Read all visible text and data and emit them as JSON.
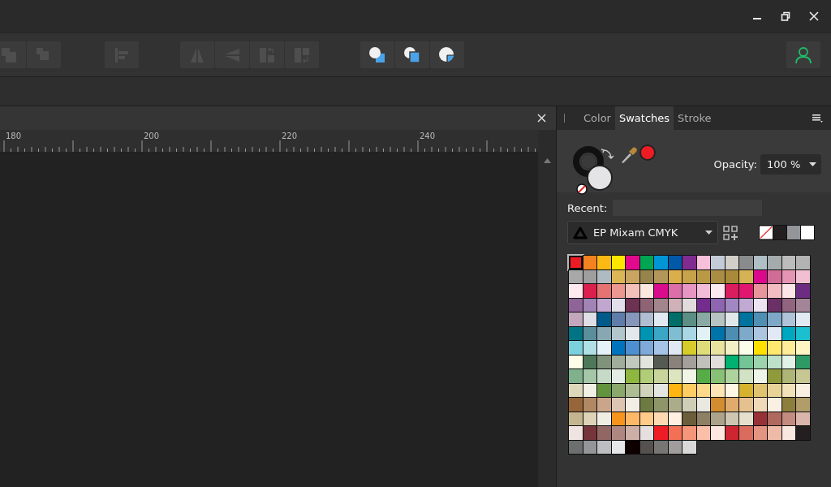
{
  "toolbar": {
    "groups": [
      {
        "buttons": [
          {
            "kind": "arrange_back",
            "disabled": true
          },
          {
            "kind": "arrange_backward",
            "disabled": true
          }
        ]
      },
      {
        "buttons": [
          {
            "kind": "align",
            "disabled": true
          }
        ]
      },
      {
        "buttons": [
          {
            "kind": "flip_h",
            "disabled": true
          },
          {
            "kind": "flip_v",
            "disabled": true
          },
          {
            "kind": "rotate_ccw",
            "disabled": true
          },
          {
            "kind": "rotate_cw",
            "disabled": true
          }
        ]
      },
      {
        "buttons": [
          {
            "kind": "add",
            "disabled": false
          },
          {
            "kind": "subtract",
            "disabled": false
          },
          {
            "kind": "intersect",
            "disabled": false
          }
        ]
      }
    ]
  },
  "ruler": {
    "labels": [
      "180",
      "200",
      "220",
      "240"
    ]
  },
  "panel": {
    "tabs": [
      {
        "label": "Color",
        "selected": false
      },
      {
        "label": "Swatches",
        "selected": true
      },
      {
        "label": "Stroke",
        "selected": false
      }
    ],
    "opacity": {
      "label": "Opacity:",
      "value": "100 %"
    },
    "recent": {
      "label": "Recent:"
    },
    "palette": {
      "name": "EP Mixam CMYK"
    },
    "quick_swatches": [
      {
        "kind": "none"
      },
      {
        "kind": "color",
        "color": "#231f20"
      },
      {
        "kind": "color",
        "color": "#939598"
      },
      {
        "kind": "color",
        "color": "#ffffff"
      }
    ],
    "swatches": [
      {
        "color": "#ed1c24",
        "selected": true
      },
      {
        "color": "#f58220",
        "selected": false
      },
      {
        "color": "#fdb913",
        "selected": false
      },
      {
        "color": "#ffe600",
        "selected": false
      },
      {
        "color": "#e20a8c",
        "selected": false
      },
      {
        "color": "#00a651",
        "selected": false
      },
      {
        "color": "#0096d6",
        "selected": false
      },
      {
        "color": "#0058a7",
        "selected": false
      },
      {
        "color": "#7f2b8f",
        "selected": false
      },
      {
        "color": "#f8bfd8",
        "selected": false
      },
      {
        "color": "#c3cbd8",
        "selected": false
      },
      {
        "color": "#d1cfc8",
        "selected": false
      },
      {
        "color": "#8a8b8d",
        "selected": false
      },
      {
        "color": "#b0bec5",
        "selected": false
      },
      {
        "color": "#a5abac",
        "selected": false
      },
      {
        "color": "#bcbcbc",
        "selected": false
      },
      {
        "color": "#b3b3b3",
        "selected": false
      },
      {
        "color": "#a8a8a8",
        "selected": false
      },
      {
        "color": "#9e9e9e",
        "selected": false
      },
      {
        "color": "#b0bac2",
        "selected": false
      },
      {
        "color": "#dcb556",
        "selected": false
      },
      {
        "color": "#c8a560",
        "selected": false
      },
      {
        "color": "#97834c",
        "selected": false
      },
      {
        "color": "#b39659",
        "selected": false
      },
      {
        "color": "#daae4a",
        "selected": false
      },
      {
        "color": "#c6a24a",
        "selected": false
      },
      {
        "color": "#b99945",
        "selected": false
      },
      {
        "color": "#a98d44",
        "selected": false
      },
      {
        "color": "#a98a3b",
        "selected": false
      },
      {
        "color": "#d5b253",
        "selected": false
      },
      {
        "color": "#db0a8c",
        "selected": false
      },
      {
        "color": "#d16c96",
        "selected": false
      },
      {
        "color": "#e595b3",
        "selected": false
      },
      {
        "color": "#f1bfd1",
        "selected": false
      },
      {
        "color": "#fde9ee",
        "selected": false
      },
      {
        "color": "#dc1f4d",
        "selected": false
      },
      {
        "color": "#e57372",
        "selected": false
      },
      {
        "color": "#ec9891",
        "selected": false
      },
      {
        "color": "#f3c0ba",
        "selected": false
      },
      {
        "color": "#fde8df",
        "selected": false
      },
      {
        "color": "#d80c8c",
        "selected": false
      },
      {
        "color": "#dc6ea9",
        "selected": false
      },
      {
        "color": "#e796c4",
        "selected": false
      },
      {
        "color": "#f2bcd9",
        "selected": false
      },
      {
        "color": "#fde9f1",
        "selected": false
      },
      {
        "color": "#da1d5f",
        "selected": false
      },
      {
        "color": "#e0166f",
        "selected": false
      },
      {
        "color": "#e8959c",
        "selected": false
      },
      {
        "color": "#f2bcc2",
        "selected": false
      },
      {
        "color": "#fde6e7",
        "selected": false
      },
      {
        "color": "#6c2c82",
        "selected": false
      },
      {
        "color": "#8f6499",
        "selected": false
      },
      {
        "color": "#a283b5",
        "selected": false
      },
      {
        "color": "#c1a6cf",
        "selected": false
      },
      {
        "color": "#e2dfeb",
        "selected": false
      },
      {
        "color": "#6d3152",
        "selected": false
      },
      {
        "color": "#8e6474",
        "selected": false
      },
      {
        "color": "#a2868c",
        "selected": false
      },
      {
        "color": "#cfb1b7",
        "selected": false
      },
      {
        "color": "#e1dcdb",
        "selected": false
      },
      {
        "color": "#742c8e",
        "selected": false
      },
      {
        "color": "#8e65b0",
        "selected": false
      },
      {
        "color": "#a288c2",
        "selected": false
      },
      {
        "color": "#c1a9d4",
        "selected": false
      },
      {
        "color": "#ece4f1",
        "selected": false
      },
      {
        "color": "#6b3166",
        "selected": false
      },
      {
        "color": "#916580",
        "selected": false
      },
      {
        "color": "#a48499",
        "selected": false
      },
      {
        "color": "#c2a7bd",
        "selected": false
      },
      {
        "color": "#e1dfe6",
        "selected": false
      },
      {
        "color": "#005a8a",
        "selected": false
      },
      {
        "color": "#607ca8",
        "selected": false
      },
      {
        "color": "#8797bb",
        "selected": false
      },
      {
        "color": "#b1bdd1",
        "selected": false
      },
      {
        "color": "#e3e9f1",
        "selected": false
      },
      {
        "color": "#006e68",
        "selected": false
      },
      {
        "color": "#5b8e85",
        "selected": false
      },
      {
        "color": "#8ba9a4",
        "selected": false
      },
      {
        "color": "#b6c4c2",
        "selected": false
      },
      {
        "color": "#e2e7ea",
        "selected": false
      },
      {
        "color": "#00739f",
        "selected": false
      },
      {
        "color": "#4f8fb4",
        "selected": false
      },
      {
        "color": "#7fa8c8",
        "selected": false
      },
      {
        "color": "#b0c4d9",
        "selected": false
      },
      {
        "color": "#e1e9f3",
        "selected": false
      },
      {
        "color": "#007385",
        "selected": false
      },
      {
        "color": "#5a8e9b",
        "selected": false
      },
      {
        "color": "#87a8b3",
        "selected": false
      },
      {
        "color": "#b3c6cc",
        "selected": false
      },
      {
        "color": "#e2e8eb",
        "selected": false
      },
      {
        "color": "#0093b2",
        "selected": false
      },
      {
        "color": "#3ba6c5",
        "selected": false
      },
      {
        "color": "#7fbdd2",
        "selected": false
      },
      {
        "color": "#a8d6e2",
        "selected": false
      },
      {
        "color": "#e1f1f6",
        "selected": false
      },
      {
        "color": "#0073a8",
        "selected": false
      },
      {
        "color": "#4e8eb3",
        "selected": false
      },
      {
        "color": "#7ea9c9",
        "selected": false
      },
      {
        "color": "#adc6df",
        "selected": false
      },
      {
        "color": "#e2e9f5",
        "selected": false
      },
      {
        "color": "#00a8bf",
        "selected": false
      },
      {
        "color": "#1bbfd0",
        "selected": false
      },
      {
        "color": "#7bd0de",
        "selected": false
      },
      {
        "color": "#b0e0e5",
        "selected": false
      },
      {
        "color": "#e3f3f7",
        "selected": false
      },
      {
        "color": "#0073bd",
        "selected": false
      },
      {
        "color": "#4d8fcf",
        "selected": false
      },
      {
        "color": "#7fa9d9",
        "selected": false
      },
      {
        "color": "#a5c4e8",
        "selected": false
      },
      {
        "color": "#e1e8f5",
        "selected": false
      },
      {
        "color": "#d6cc2a",
        "selected": false
      },
      {
        "color": "#dedd7a",
        "selected": false
      },
      {
        "color": "#e9e3a0",
        "selected": false
      },
      {
        "color": "#f3f0c6",
        "selected": false
      },
      {
        "color": "#fbfde8",
        "selected": false
      },
      {
        "color": "#ffe000",
        "selected": false
      },
      {
        "color": "#ffe86e",
        "selected": false
      },
      {
        "color": "#ffec9b",
        "selected": false
      },
      {
        "color": "#fef5c4",
        "selected": false
      },
      {
        "color": "#fffde7",
        "selected": false
      },
      {
        "color": "#4e7859",
        "selected": false
      },
      {
        "color": "#7f937a",
        "selected": false
      },
      {
        "color": "#a0ad9b",
        "selected": false
      },
      {
        "color": "#c1c9bf",
        "selected": false
      },
      {
        "color": "#e1e5de",
        "selected": false
      },
      {
        "color": "#555b52",
        "selected": false
      },
      {
        "color": "#8a817b",
        "selected": false
      },
      {
        "color": "#a39f9a",
        "selected": false
      },
      {
        "color": "#c2c0bb",
        "selected": false
      },
      {
        "color": "#e2dedb",
        "selected": false
      },
      {
        "color": "#00b271",
        "selected": false
      },
      {
        "color": "#74c595",
        "selected": false
      },
      {
        "color": "#9dd4ae",
        "selected": false
      },
      {
        "color": "#bee2c9",
        "selected": false
      },
      {
        "color": "#e3f2e6",
        "selected": false
      },
      {
        "color": "#2e9a66",
        "selected": false
      },
      {
        "color": "#7fb28c",
        "selected": false
      },
      {
        "color": "#a3c7a7",
        "selected": false
      },
      {
        "color": "#c5dbc8",
        "selected": false
      },
      {
        "color": "#e4ede5",
        "selected": false
      },
      {
        "color": "#8db73f",
        "selected": false
      },
      {
        "color": "#b1cd77",
        "selected": false
      },
      {
        "color": "#c7d49b",
        "selected": false
      },
      {
        "color": "#dce4c0",
        "selected": false
      },
      {
        "color": "#f1f5e6",
        "selected": false
      },
      {
        "color": "#57ac48",
        "selected": false
      },
      {
        "color": "#88c175",
        "selected": false
      },
      {
        "color": "#afd39d",
        "selected": false
      },
      {
        "color": "#d1e3c4",
        "selected": false
      },
      {
        "color": "#eef6ea",
        "selected": false
      },
      {
        "color": "#8f9a3d",
        "selected": false
      },
      {
        "color": "#aeb576",
        "selected": false
      },
      {
        "color": "#c6c793",
        "selected": false
      },
      {
        "color": "#ded8ba",
        "selected": false
      },
      {
        "color": "#f0f0e4",
        "selected": false
      },
      {
        "color": "#62943e",
        "selected": false
      },
      {
        "color": "#8aa86b",
        "selected": false
      },
      {
        "color": "#adbd94",
        "selected": false
      },
      {
        "color": "#d1d4bb",
        "selected": false
      },
      {
        "color": "#e3e6e2",
        "selected": false
      },
      {
        "color": "#ffb612",
        "selected": false
      },
      {
        "color": "#fecd64",
        "selected": false
      },
      {
        "color": "#ffd98a",
        "selected": false
      },
      {
        "color": "#ffe5b5",
        "selected": false
      },
      {
        "color": "#fff7e5",
        "selected": false
      },
      {
        "color": "#d6b22f",
        "selected": false
      },
      {
        "color": "#e0c36e",
        "selected": false
      },
      {
        "color": "#e9d497",
        "selected": false
      },
      {
        "color": "#f1e2b9",
        "selected": false
      },
      {
        "color": "#f9f0e1",
        "selected": false
      },
      {
        "color": "#97653a",
        "selected": false
      },
      {
        "color": "#b08863",
        "selected": false
      },
      {
        "color": "#c9a689",
        "selected": false
      },
      {
        "color": "#dec5b1",
        "selected": false
      },
      {
        "color": "#f2ede5",
        "selected": false
      },
      {
        "color": "#6d7a42",
        "selected": false
      },
      {
        "color": "#8e9568",
        "selected": false
      },
      {
        "color": "#abac89",
        "selected": false
      },
      {
        "color": "#cfcdb6",
        "selected": false
      },
      {
        "color": "#e9e8e1",
        "selected": false
      },
      {
        "color": "#d38c2f",
        "selected": false
      },
      {
        "color": "#dfac6e",
        "selected": false
      },
      {
        "color": "#e6c190",
        "selected": false
      },
      {
        "color": "#f1d8b8",
        "selected": false
      },
      {
        "color": "#f9f0e3",
        "selected": false
      },
      {
        "color": "#8e7e3c",
        "selected": false
      },
      {
        "color": "#b09d6a",
        "selected": false
      },
      {
        "color": "#c4b591",
        "selected": false
      },
      {
        "color": "#dcd3b8",
        "selected": false
      },
      {
        "color": "#f0ede3",
        "selected": false
      },
      {
        "color": "#f7941e",
        "selected": false
      },
      {
        "color": "#fdb968",
        "selected": false
      },
      {
        "color": "#fecb8b",
        "selected": false
      },
      {
        "color": "#fedab3",
        "selected": false
      },
      {
        "color": "#feefe0",
        "selected": false
      },
      {
        "color": "#6c5e3b",
        "selected": false
      },
      {
        "color": "#8e8064",
        "selected": false
      },
      {
        "color": "#ada28a",
        "selected": false
      },
      {
        "color": "#cfc6b2",
        "selected": false
      },
      {
        "color": "#e5dfcd",
        "selected": false
      },
      {
        "color": "#973136",
        "selected": false
      },
      {
        "color": "#b0695e",
        "selected": false
      },
      {
        "color": "#c48b80",
        "selected": false
      },
      {
        "color": "#dab5ab",
        "selected": false
      },
      {
        "color": "#f0e4e3",
        "selected": false
      },
      {
        "color": "#76353b",
        "selected": false
      },
      {
        "color": "#926663",
        "selected": false
      },
      {
        "color": "#ae8880",
        "selected": false
      },
      {
        "color": "#cdafa7",
        "selected": false
      },
      {
        "color": "#e6dfdf",
        "selected": false
      },
      {
        "color": "#ed1c25",
        "selected": false
      },
      {
        "color": "#f37055",
        "selected": false
      },
      {
        "color": "#f59579",
        "selected": false
      },
      {
        "color": "#fbbfa9",
        "selected": false
      },
      {
        "color": "#fee8df",
        "selected": false
      },
      {
        "color": "#cd2531",
        "selected": false
      },
      {
        "color": "#d96c5c",
        "selected": false
      },
      {
        "color": "#e39582",
        "selected": false
      },
      {
        "color": "#eebba8",
        "selected": false
      },
      {
        "color": "#f9e8e0",
        "selected": false
      },
      {
        "color": "#231f20",
        "selected": false
      },
      {
        "color": "#6d6e70",
        "selected": false
      },
      {
        "color": "#939598",
        "selected": false
      },
      {
        "color": "#bcbec0",
        "selected": false
      },
      {
        "color": "#e6e7e8",
        "selected": false
      },
      {
        "color": "#0f0000",
        "selected": false
      },
      {
        "color": "#55514f",
        "selected": false
      },
      {
        "color": "#787575",
        "selected": false
      },
      {
        "color": "#a09d9c",
        "selected": false
      },
      {
        "color": "#d9d9d9",
        "selected": false
      }
    ]
  }
}
